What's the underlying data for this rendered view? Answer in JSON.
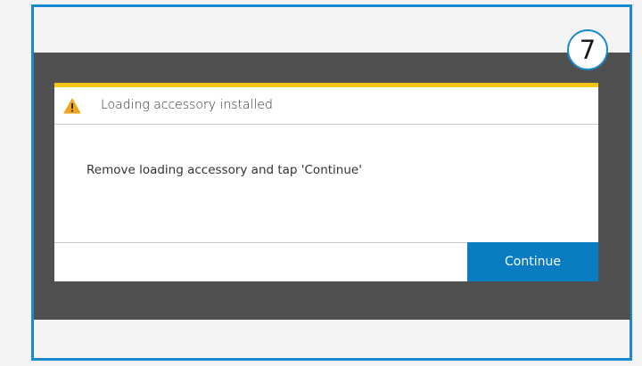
{
  "step_badge": {
    "number": "7"
  },
  "colors": {
    "frame_border": "#1a8ad0",
    "screen_background": "#505050",
    "dialog_accent": "#f5c518",
    "warning_icon": "#f0a31c",
    "continue_button": "#0a7cc1"
  },
  "dialog": {
    "icon": "warning-icon",
    "title": "Loading accessory installed",
    "message": "Remove loading accessory and tap 'Continue'",
    "continue_label": "Continue"
  }
}
